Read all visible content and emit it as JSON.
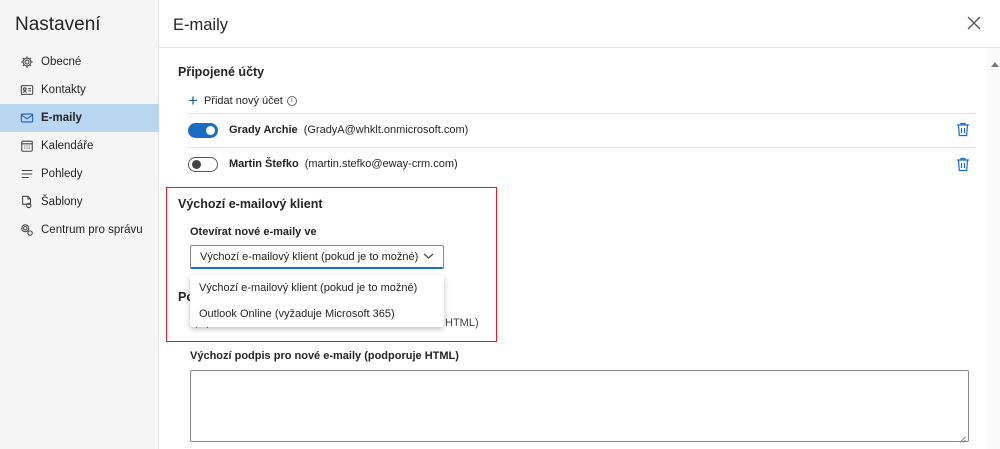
{
  "sidebar": {
    "title": "Nastavení",
    "items": [
      {
        "label": "Obecné",
        "icon": "gear-icon"
      },
      {
        "label": "Kontakty",
        "icon": "contact-card-icon"
      },
      {
        "label": "E-maily",
        "icon": "mail-icon",
        "active": true
      },
      {
        "label": "Kalendáře",
        "icon": "calendar-icon"
      },
      {
        "label": "Pohledy",
        "icon": "list-lines-icon"
      },
      {
        "label": "Šablony",
        "icon": "template-icon"
      },
      {
        "label": "Centrum pro správu",
        "icon": "admin-gear-icon"
      }
    ]
  },
  "header": {
    "title": "E-maily"
  },
  "connected": {
    "title": "Připojené účty",
    "add_label": "Přidat nový účet",
    "accounts": [
      {
        "name": "Grady Archie",
        "email": "(GradyA@whklt.onmicrosoft.com)",
        "enabled": true
      },
      {
        "name": "Martin Štefko",
        "email": "(martin.stefko@eway-crm.com)",
        "enabled": false
      }
    ]
  },
  "default_client": {
    "title": "Výchozí e-mailový klient",
    "open_label": "Otevírat nové e-maily ve",
    "selected": "Výchozí e-mailový klient (pokud je to možné)",
    "options": [
      "Výchozí e-mailový klient (pokud je to možné)",
      "Outlook Online (vyžaduje Microsoft 365)"
    ]
  },
  "behind": {
    "partial_title": "Po",
    "partial_text": "HTML)"
  },
  "signature": {
    "label": "Výchozí podpis pro nové e-maily (podporuje HTML)",
    "value": ""
  },
  "colors": {
    "accent": "#1a6dc6",
    "active_nav": "#b9d7f1",
    "highlight": "#d1242f"
  }
}
